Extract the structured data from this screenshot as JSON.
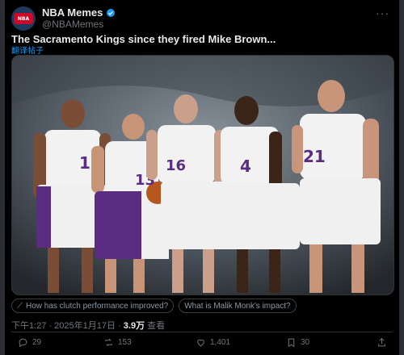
{
  "tweet": {
    "display_name": "NBA Memes",
    "handle": "@NBAMemes",
    "avatar_label": "NBA",
    "text": "The Sacramento Kings since they fired Mike Brown...",
    "translate_label": "翻译帖子",
    "timestamp": "下午1:27 · 2025年1月17日 · ",
    "views_count": "3.9万",
    "views_label": " 查看"
  },
  "image": {
    "jersey_numbers": [
      "1",
      "13",
      "16",
      "4",
      "21"
    ]
  },
  "suggestions": [
    {
      "icon": "grok-icon",
      "label": "How has clutch performance improved?"
    },
    {
      "icon": "",
      "label": "What is Malik Monk's impact?"
    }
  ],
  "actions": {
    "replies": "29",
    "reposts": "153",
    "likes": "1,401",
    "bookmarks": "30"
  },
  "colors": {
    "accent": "#1d9bf0",
    "background": "#000000",
    "kings_purple": "#5a2d82"
  }
}
